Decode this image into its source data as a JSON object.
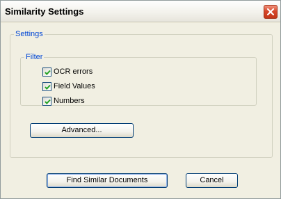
{
  "window": {
    "title": "Similarity Settings"
  },
  "settings_group": {
    "legend": "Settings",
    "filter_group": {
      "legend": "Filter",
      "options": [
        {
          "label": "OCR errors",
          "checked": true
        },
        {
          "label": "Field Values",
          "checked": true
        },
        {
          "label": "Numbers",
          "checked": true
        }
      ]
    },
    "advanced_label": "Advanced..."
  },
  "buttons": {
    "find_label": "Find Similar Documents",
    "cancel_label": "Cancel"
  },
  "colors": {
    "legend_text": "#0046d5",
    "close_button": "#d6472a",
    "checkmark": "#21a121"
  },
  "icons": {
    "close": "close-icon",
    "check": "checkmark-icon"
  }
}
